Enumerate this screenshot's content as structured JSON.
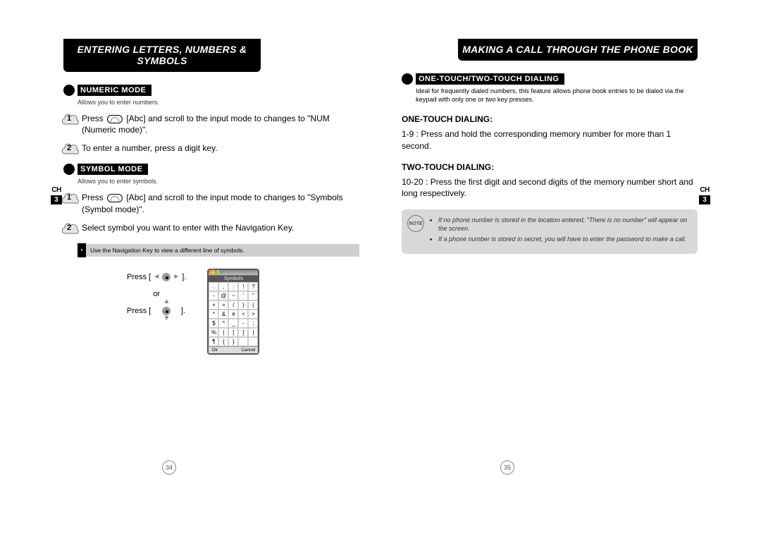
{
  "left": {
    "header": "ENTERING LETTERS, NUMBERS & SYMBOLS",
    "chapter_label": "CH",
    "chapter_num": "3",
    "numeric": {
      "title": "NUMERIC MODE",
      "sub": "Allows you to enter numbers.",
      "step1_a": "Press ",
      "step1_b": " [Abc] and scroll to the input mode to changes to \"NUM (Numeric mode)\".",
      "step2": "To enter a number, press a digit key."
    },
    "symbol": {
      "title": "SYMBOL MODE",
      "sub": "Allows you to enter symbols.",
      "step1_a": "Press ",
      "step1_b": " [Abc] and scroll to the input mode to changes to \"Symbols (Symbol mode)\".",
      "step2": "Select symbol you want to enter with the Navigation Key.",
      "note": "Use the Navigation Key to view a different line of symbols.",
      "press1": "Press [",
      "or": "or",
      "press2": "Press [",
      "bracket_close": "].",
      "phone_title": "Symbols",
      "phone_ok": "Ok",
      "phone_cancel": "Cancel",
      "grid": [
        ".",
        ",",
        ":",
        "!",
        "?",
        "-",
        "@",
        "~",
        "'",
        "\"",
        "+",
        "=",
        "/",
        ")",
        "(",
        "*",
        "&",
        "#",
        "<",
        ">",
        "$",
        "^",
        "_",
        "-",
        ";",
        "%",
        "|",
        "[",
        "]",
        "|",
        "¶",
        "{",
        "}",
        "",
        ""
      ]
    },
    "pagenum": "34"
  },
  "right": {
    "header": "MAKING A CALL THROUGH THE PHONE BOOK",
    "chapter_label": "CH",
    "chapter_num": "3",
    "section_title": "ONE-TOUCH/TWO-TOUCH DIALING",
    "ideal": "Ideal for frequently dialed numbers, this feature allows phone book entries to be dialed via the keypad with only one or two key presses.",
    "one_heading": "ONE-TOUCH DIALING:",
    "one_body": "1-9 : Press and hold the corresponding memory number for more than 1 second.",
    "two_heading": "TWO-TOUCH DIALING:",
    "two_body": "10-20 : Press the first digit and second digits of the memory number short and long respectively.",
    "note_label": "NOTE",
    "note1": "If no phone number is stored in the location entered, \"There is no number\" will appear on the screen.",
    "note2": "If a phone number is stored in secret, you will have to enter the password to make a call.",
    "pagenum": "35"
  }
}
